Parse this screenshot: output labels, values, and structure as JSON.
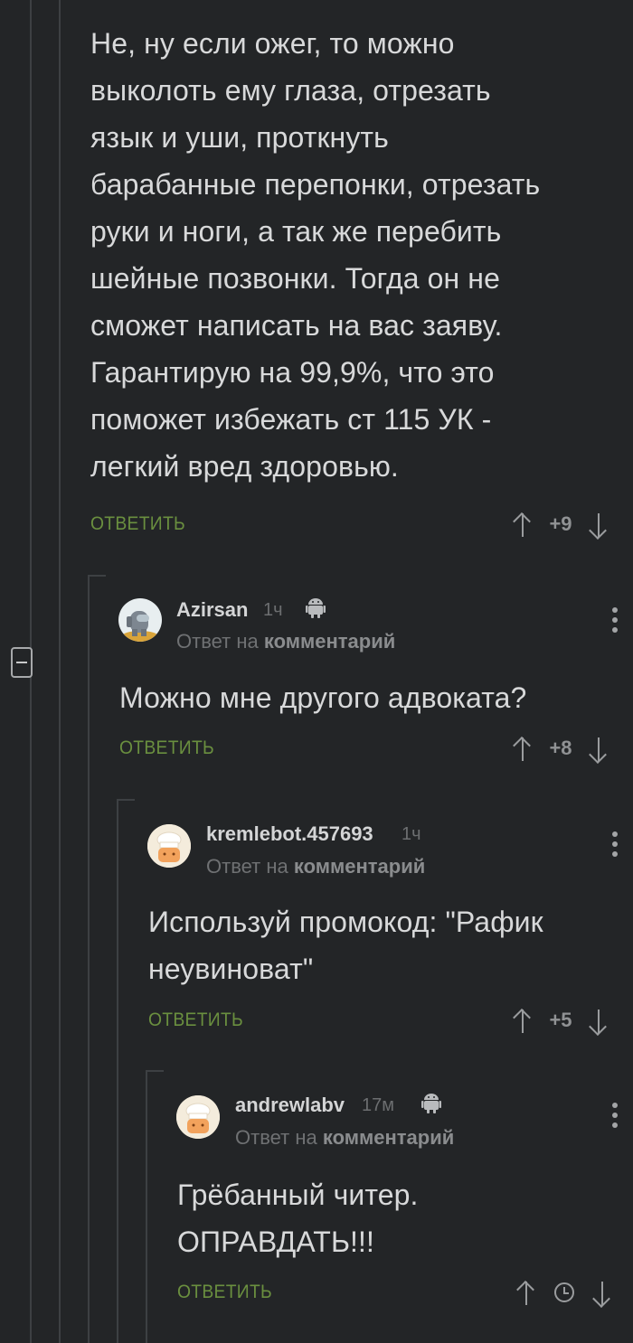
{
  "comments": [
    {
      "text": "Не, ну если ожег, то можно\nвыколоть ему глаза, отрезать\nязык и уши, проткнуть\nбарабанные перепонки, отрезать\nруки и ноги, а так же перебить\nшейные позвонки. Тогда он не\nсможет написать на вас заяву.\nГарантирую на 99,9%, что это\nпоможет избежать ст 115 УК -\nлегкий вред здоровью.",
      "reply_label": "ОТВЕТИТЬ",
      "score": "+9"
    },
    {
      "username": "Azirsan",
      "time": "1ч",
      "reply_to_prefix": "Ответ на",
      "reply_to_link": "комментарий",
      "text": "Можно мне другого адвоката?",
      "reply_label": "ОТВЕТИТЬ",
      "score": "+8",
      "avatar_icon": "among-us-crewmate-avatar",
      "platform_icon": "android-icon"
    },
    {
      "username": "kremlebot.457693",
      "time": "1ч",
      "reply_to_prefix": "Ответ на",
      "reply_to_link": "комментарий",
      "text": "Используй промокод: \"Рафик\nнеувиноват\"",
      "reply_label": "ОТВЕТИТЬ",
      "score": "+5",
      "avatar_icon": "chef-avatar"
    },
    {
      "username": "andrewlabv",
      "time": "17м",
      "reply_to_prefix": "Ответ на",
      "reply_to_link": "комментарий",
      "text": "Грёбанный читер.\nОПРАВДАТЬ!!!",
      "reply_label": "ОТВЕТИТЬ",
      "score_icon": "clock-icon",
      "avatar_icon": "chef-avatar",
      "platform_icon": "android-icon"
    }
  ],
  "colors": {
    "background": "#232527",
    "reply_green": "#6a8f3f",
    "thread_line": "#3d4043"
  }
}
